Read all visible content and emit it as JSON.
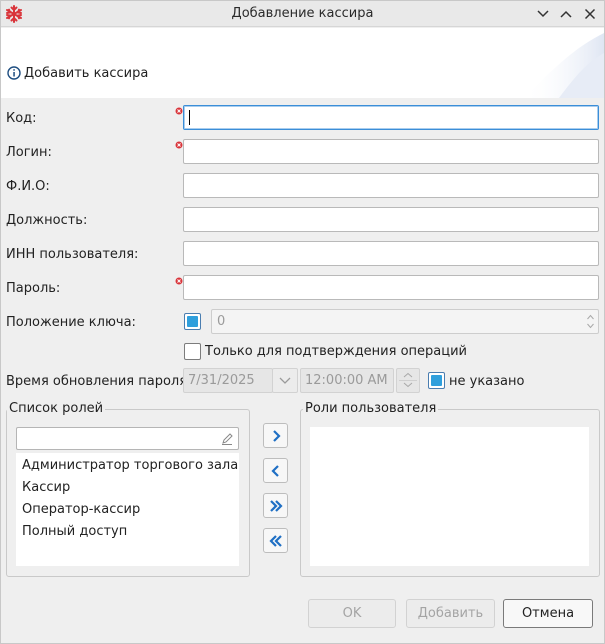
{
  "window": {
    "title": "Добавление кассира"
  },
  "header": {
    "text": "Добавить кассира",
    "icon": "info-icon"
  },
  "form": {
    "code_label": "Код:",
    "login_label": "Логин:",
    "fio_label": "Ф.И.О:",
    "position_label": "Должность:",
    "inn_label": "ИНН пользователя:",
    "password_label": "Пароль:",
    "key_position_label": "Положение ключа:",
    "key_position_value": "0",
    "confirm_only_label": "Только для подтверждения операций",
    "password_update_label": "Время обновления пароля:",
    "date_value": "7/31/2025",
    "time_value": "12:00:00 AM",
    "not_specified_label": "не указано"
  },
  "roles": {
    "list_title": "Список ролей",
    "user_roles_title": "Роли пользователя",
    "items": [
      "Администратор торгового зала",
      "Кассир",
      "Оператор-кассир",
      "Полный доступ"
    ]
  },
  "buttons": {
    "ok": "OK",
    "add": "Добавить",
    "cancel": "Отмена"
  },
  "colors": {
    "accent": "#3b8ed8",
    "required": "#d9343a",
    "checkbox_fill": "#2f9fdc",
    "move_arrow": "#1f6fc4"
  }
}
